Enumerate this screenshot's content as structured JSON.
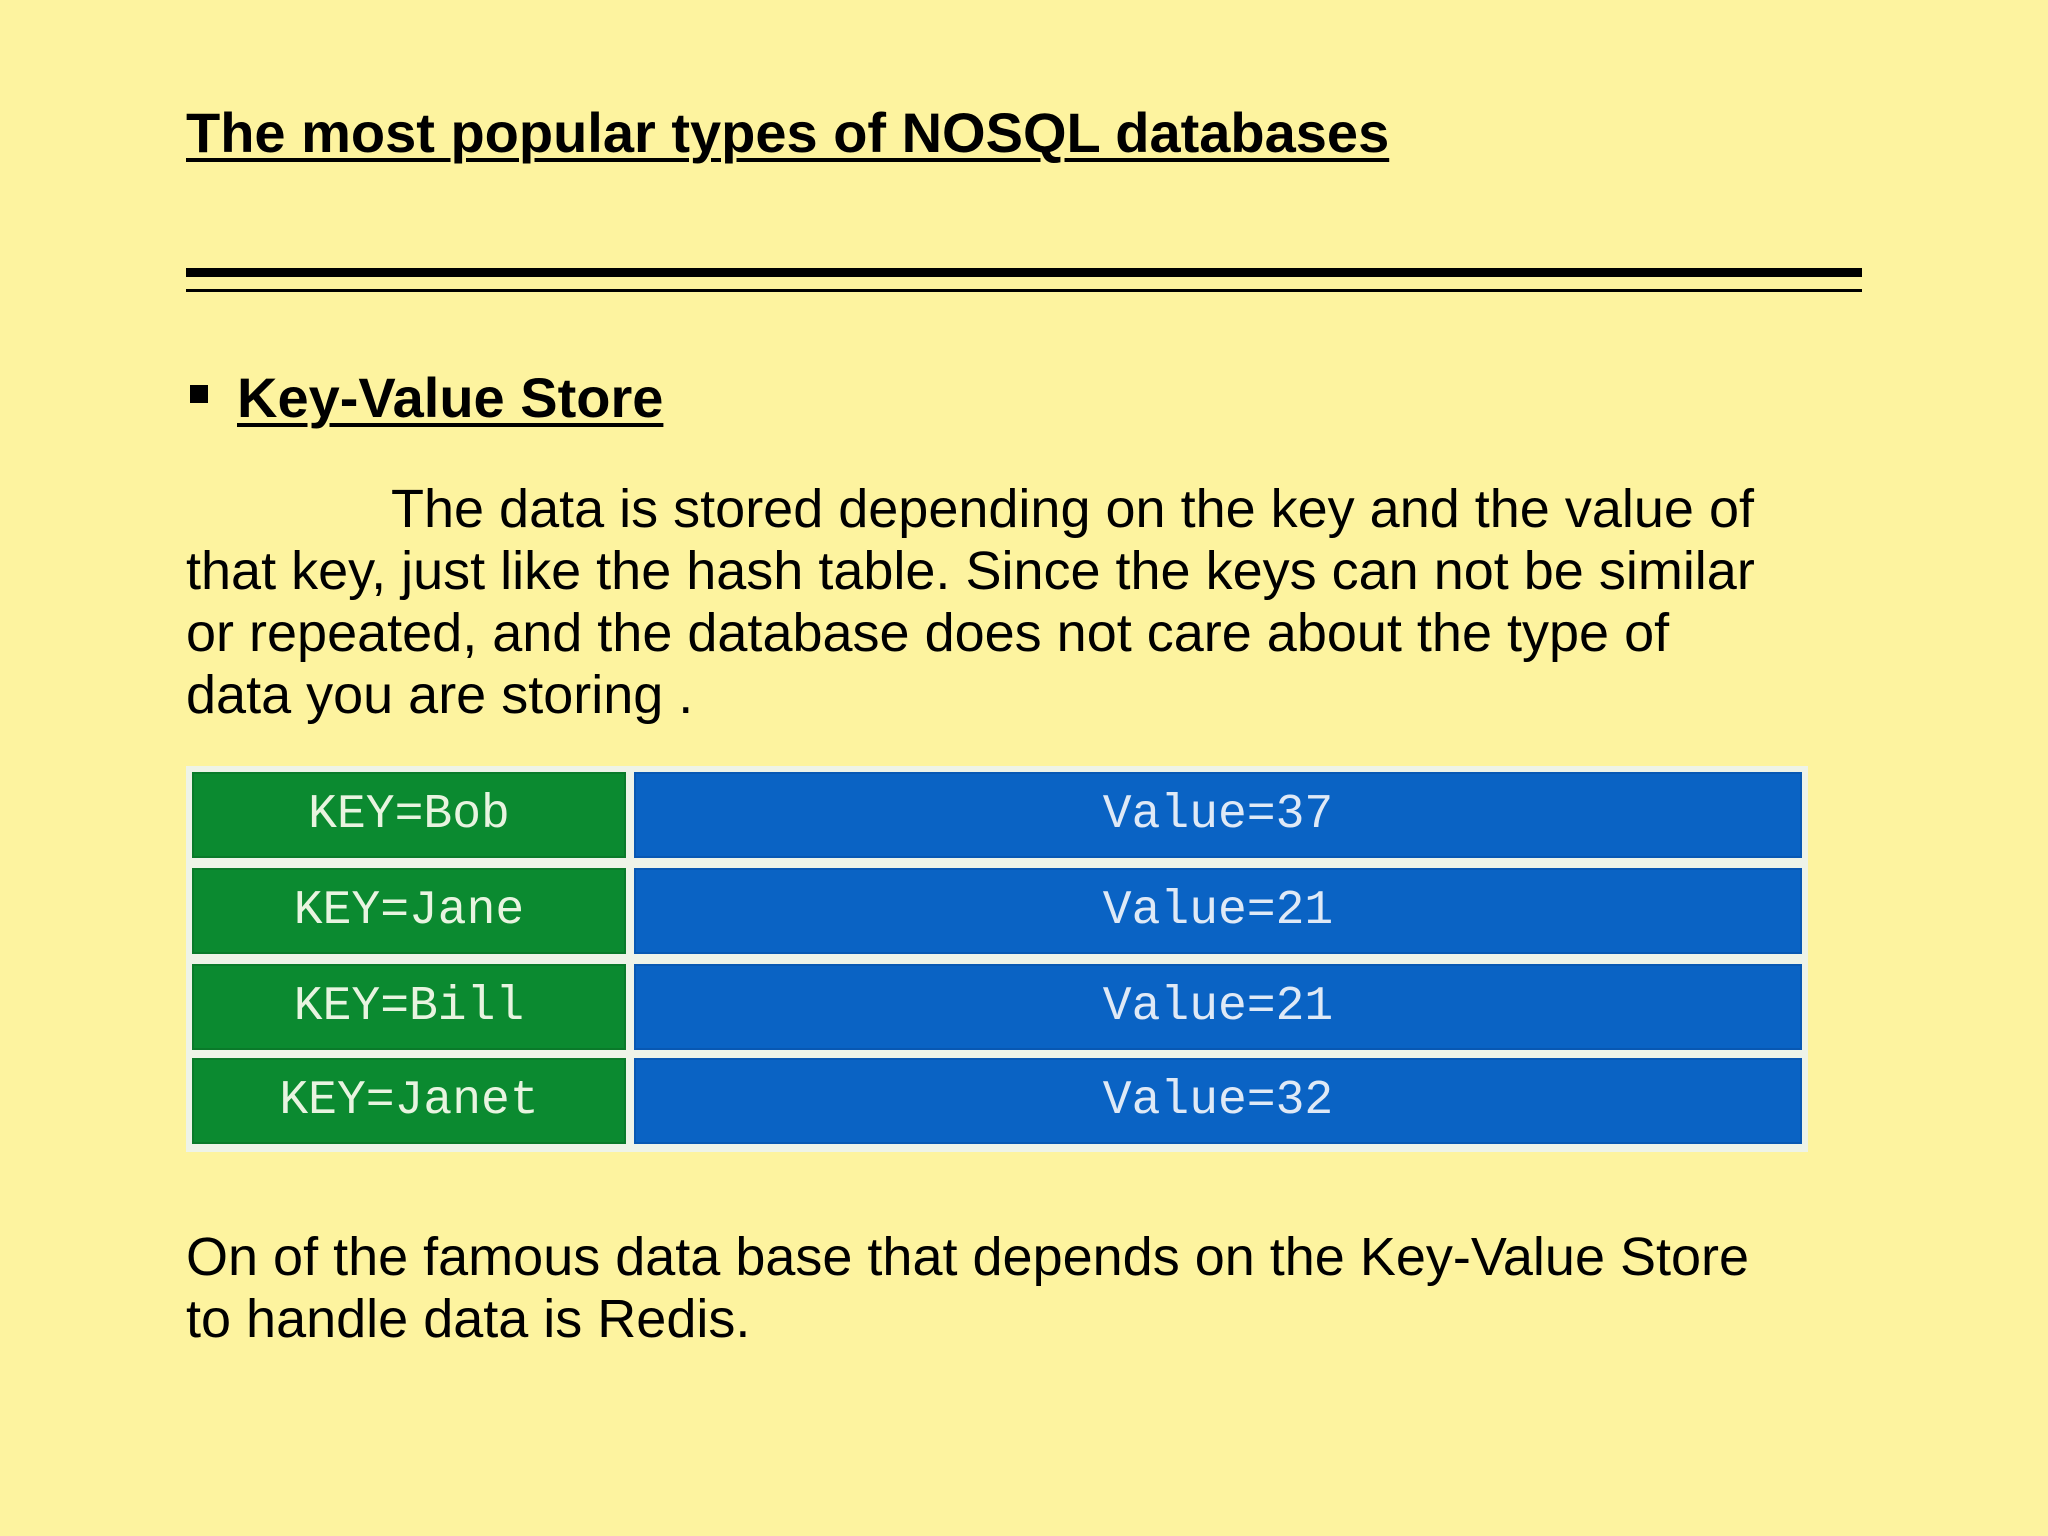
{
  "slide": {
    "title": "The most popular types of NOSQL databases",
    "section_heading": "Key-Value Store",
    "paragraph_lines": [
      "The data is stored depending on the key and the value of",
      "that key, just like the hash table. Since the keys can not be similar",
      "or repeated, and the database does not care about the type of",
      "data you are storing ."
    ],
    "table": {
      "rows": [
        {
          "key": "KEY=Bob",
          "value": "Value=37"
        },
        {
          "key": "KEY=Jane",
          "value": "Value=21"
        },
        {
          "key": "KEY=Bill",
          "value": "Value=21"
        },
        {
          "key": "KEY=Janet",
          "value": "Value=32"
        }
      ]
    },
    "closing_lines": [
      "On of the famous data base that depends on the Key-Value Store",
      "to handle data is Redis."
    ]
  },
  "colors": {
    "background": "#fdf39f",
    "key_cell": "#0b8a30",
    "value_cell": "#0a63c4"
  },
  "icons": {
    "bullet": "square-bullet-icon"
  }
}
